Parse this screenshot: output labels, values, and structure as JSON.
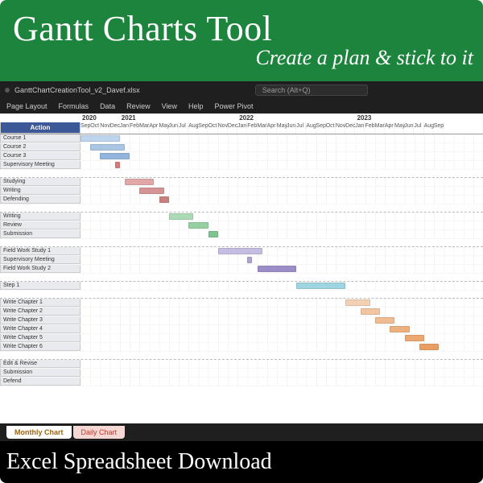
{
  "promo": {
    "title": "Gantt Charts Tool",
    "subtitle": "Create a plan & stick to it",
    "footer": "Excel Spreadsheet Download"
  },
  "app": {
    "filename": "GanttChartCreationTool_v2_Davef.xlsx",
    "search_placeholder": "Search (Alt+Q)",
    "ribbon": [
      "Page Layout",
      "Formulas",
      "Data",
      "Review",
      "View",
      "Help",
      "Power Pivot"
    ],
    "sheet_tabs": {
      "active": "Monthly Chart",
      "other": "Daily Chart"
    }
  },
  "timeline": {
    "years": [
      {
        "label": "2020",
        "span": 4
      },
      {
        "label": "2021",
        "span": 12
      },
      {
        "label": "2022",
        "span": 12
      },
      {
        "label": "2023",
        "span": 12
      }
    ],
    "months": [
      "Sep",
      "Oct",
      "Nov",
      "Dec",
      "Jan",
      "Feb",
      "Mar",
      "Apr",
      "May",
      "Jun",
      "Jul",
      "Aug",
      "Sep",
      "Oct",
      "Nov",
      "Dec",
      "Jan",
      "Feb",
      "Mar",
      "Apr",
      "May",
      "Jun",
      "Jul",
      "Aug",
      "Sep",
      "Oct",
      "Nov",
      "Dec",
      "Jan",
      "Feb",
      "Mar",
      "Apr",
      "May",
      "Jun",
      "Jul",
      "Aug",
      "Sep"
    ]
  },
  "action_header": "Action",
  "rows": [
    {
      "label": "Course 1",
      "bar": {
        "start": 0,
        "dur": 4,
        "color": "#a9c7e8"
      }
    },
    {
      "label": "Course 2",
      "bar": {
        "start": 1,
        "dur": 3.5,
        "color": "#8fb4dd"
      }
    },
    {
      "label": "Course 3",
      "bar": {
        "start": 2,
        "dur": 3,
        "color": "#6f9cd1"
      }
    },
    {
      "label": "Supervisory Meeting",
      "bar": {
        "start": 3.5,
        "dur": 0.5,
        "color": "#c94f4f"
      }
    },
    {
      "gap": true
    },
    {
      "label": "Studying",
      "bar": {
        "start": 4.5,
        "dur": 3,
        "color": "#d98b8b"
      }
    },
    {
      "label": "Writing",
      "bar": {
        "start": 6,
        "dur": 2.5,
        "color": "#c97070"
      }
    },
    {
      "label": "Defending",
      "bar": {
        "start": 8,
        "dur": 1,
        "color": "#b85555"
      }
    },
    {
      "gap": true
    },
    {
      "label": "Writing",
      "bar": {
        "start": 9,
        "dur": 2.5,
        "color": "#8fcf9b"
      }
    },
    {
      "label": "Review",
      "bar": {
        "start": 11,
        "dur": 2,
        "color": "#73c183"
      }
    },
    {
      "label": "Submission",
      "bar": {
        "start": 13,
        "dur": 1,
        "color": "#55b06a"
      }
    },
    {
      "gap": true
    },
    {
      "label": "Field Work Study 1",
      "bar": {
        "start": 14,
        "dur": 4.5,
        "color": "#b3a7d9"
      }
    },
    {
      "label": "Supervisory Meeting",
      "bar": {
        "start": 17,
        "dur": 0.5,
        "color": "#9585c9"
      }
    },
    {
      "label": "Field Work Study 2",
      "bar": {
        "start": 18,
        "dur": 4,
        "color": "#7a67b8"
      }
    },
    {
      "gap": true
    },
    {
      "label": "Step 1",
      "bar": {
        "start": 22,
        "dur": 5,
        "color": "#7fc8d6"
      }
    },
    {
      "gap": true
    },
    {
      "label": "Write Chapter 1",
      "bar": {
        "start": 27,
        "dur": 2.5,
        "color": "#f2c29b"
      }
    },
    {
      "label": "Write Chapter 2",
      "bar": {
        "start": 28.5,
        "dur": 2,
        "color": "#efb382"
      }
    },
    {
      "label": "Write Chapter 3",
      "bar": {
        "start": 30,
        "dur": 2,
        "color": "#eca66c"
      }
    },
    {
      "label": "Write Chapter 4",
      "bar": {
        "start": 31.5,
        "dur": 2,
        "color": "#e99856"
      }
    },
    {
      "label": "Write Chapter 5",
      "bar": {
        "start": 33,
        "dur": 2,
        "color": "#e68b41"
      }
    },
    {
      "label": "Write Chapter 6",
      "bar": {
        "start": 34.5,
        "dur": 2,
        "color": "#e37e2d"
      }
    },
    {
      "gap": true
    },
    {
      "label": "Edit & Revise"
    },
    {
      "label": "Submission"
    },
    {
      "label": "Defend"
    }
  ]
}
